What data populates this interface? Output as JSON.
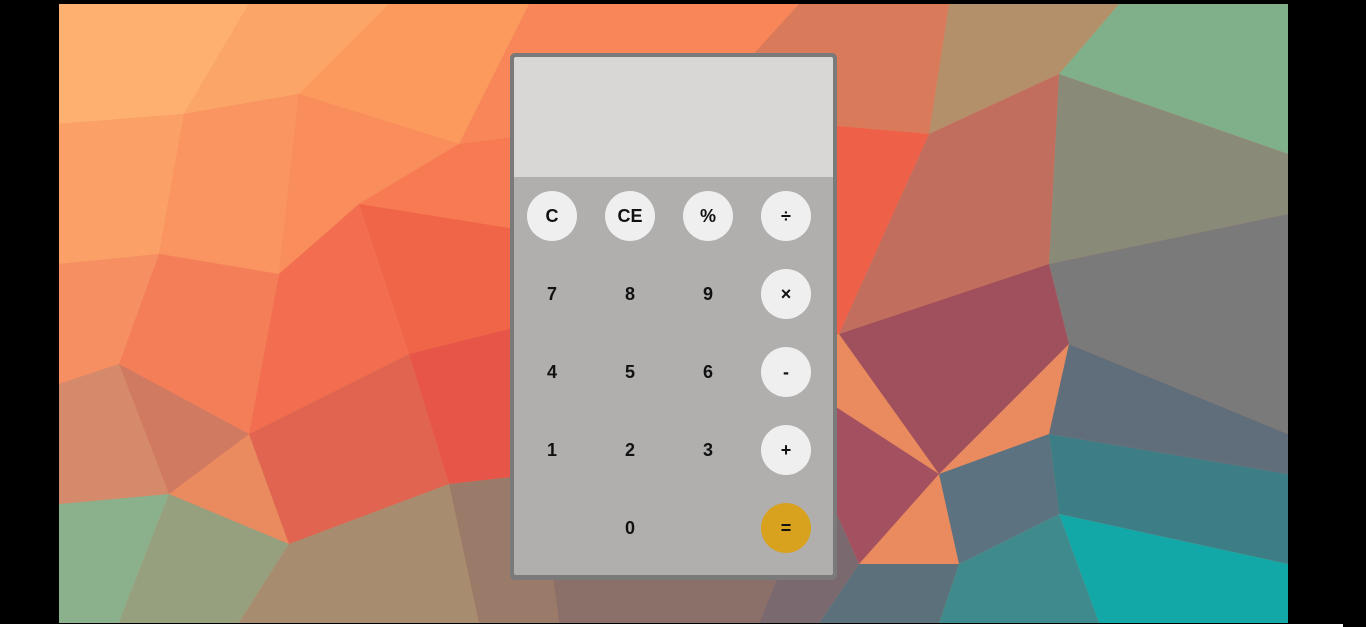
{
  "display": {
    "value": ""
  },
  "keys": {
    "clear": "C",
    "clear_entry": "CE",
    "percent": "%",
    "divide": "÷",
    "seven": "7",
    "eight": "8",
    "nine": "9",
    "multiply": "×",
    "four": "4",
    "five": "5",
    "six": "6",
    "subtract": "-",
    "one": "1",
    "two": "2",
    "three": "3",
    "add": "+",
    "zero": "0",
    "equals": "="
  },
  "colors": {
    "accent": "#d9a21e",
    "display_bg": "#d9d7d6",
    "keypad_bg": "#b0afae",
    "frame": "#7a7a7a",
    "key_light": "#efefef"
  }
}
